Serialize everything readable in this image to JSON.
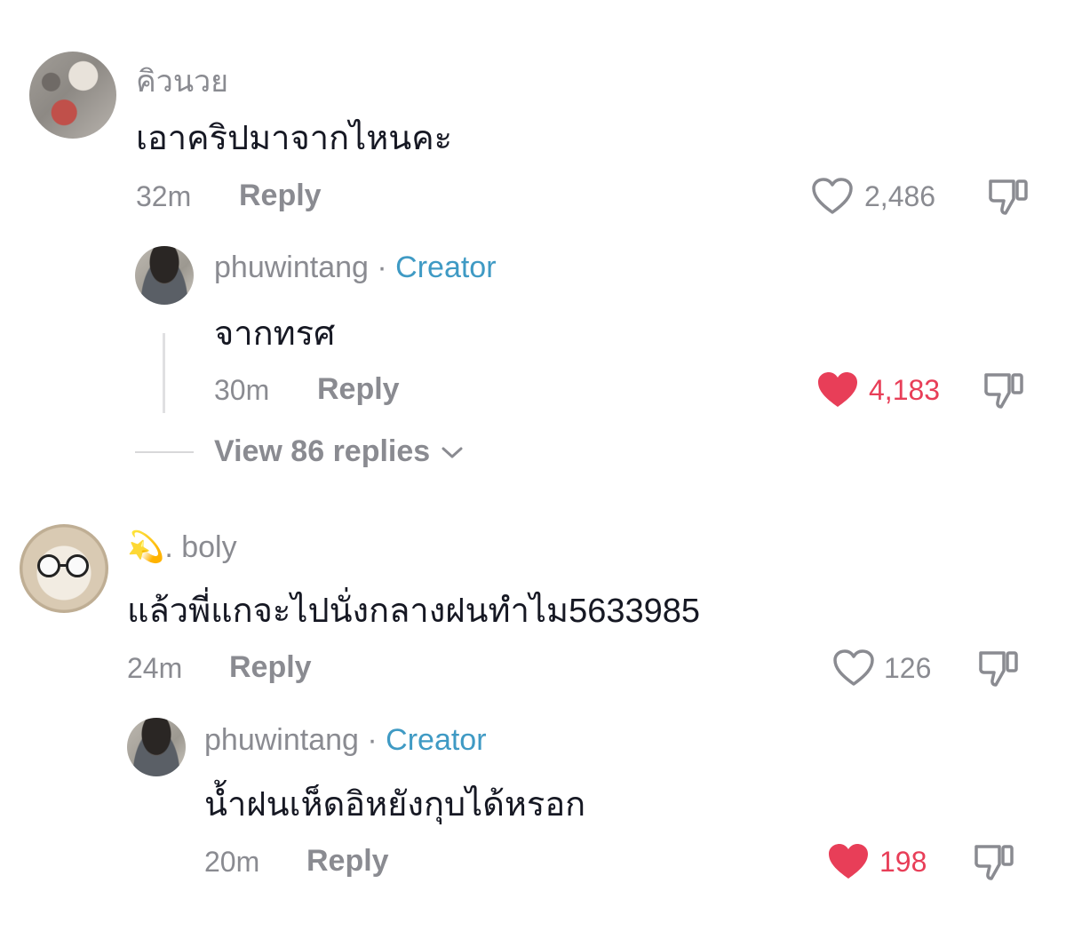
{
  "comments": [
    {
      "username": "คิวนวย",
      "text": "เอาคริปมาจากไหนคะ",
      "time": "32m",
      "reply_label": "Reply",
      "likes": "2,486",
      "liked": false,
      "replies": [
        {
          "username": "phuwintang",
          "separator": "·",
          "badge": "Creator",
          "text": "จากทรศ",
          "time": "30m",
          "reply_label": "Reply",
          "likes": "4,183",
          "liked": true
        }
      ],
      "view_replies_label": "View 86 replies"
    },
    {
      "username_emoji": "💫",
      "username": ". boly",
      "text": "แล้วพี่แกจะไปนั่งกลางฝนทำไม5633985",
      "time": "24m",
      "reply_label": "Reply",
      "likes": "126",
      "liked": false,
      "replies": [
        {
          "username": "phuwintang",
          "separator": "·",
          "badge": "Creator",
          "text": "น้ำฝนเห็ดอิหยังกุบได้หรอก",
          "time": "20m",
          "reply_label": "Reply",
          "likes": "198",
          "liked": true
        }
      ]
    }
  ],
  "colors": {
    "liked": "#e83e58",
    "creator_badge": "#3f9ac4",
    "muted": "#8a8b91",
    "text": "#161823"
  },
  "icons": {
    "like": "heart-outline-icon",
    "liked": "heart-filled-icon",
    "dislike": "thumbs-down-icon",
    "expand": "chevron-down-icon"
  }
}
